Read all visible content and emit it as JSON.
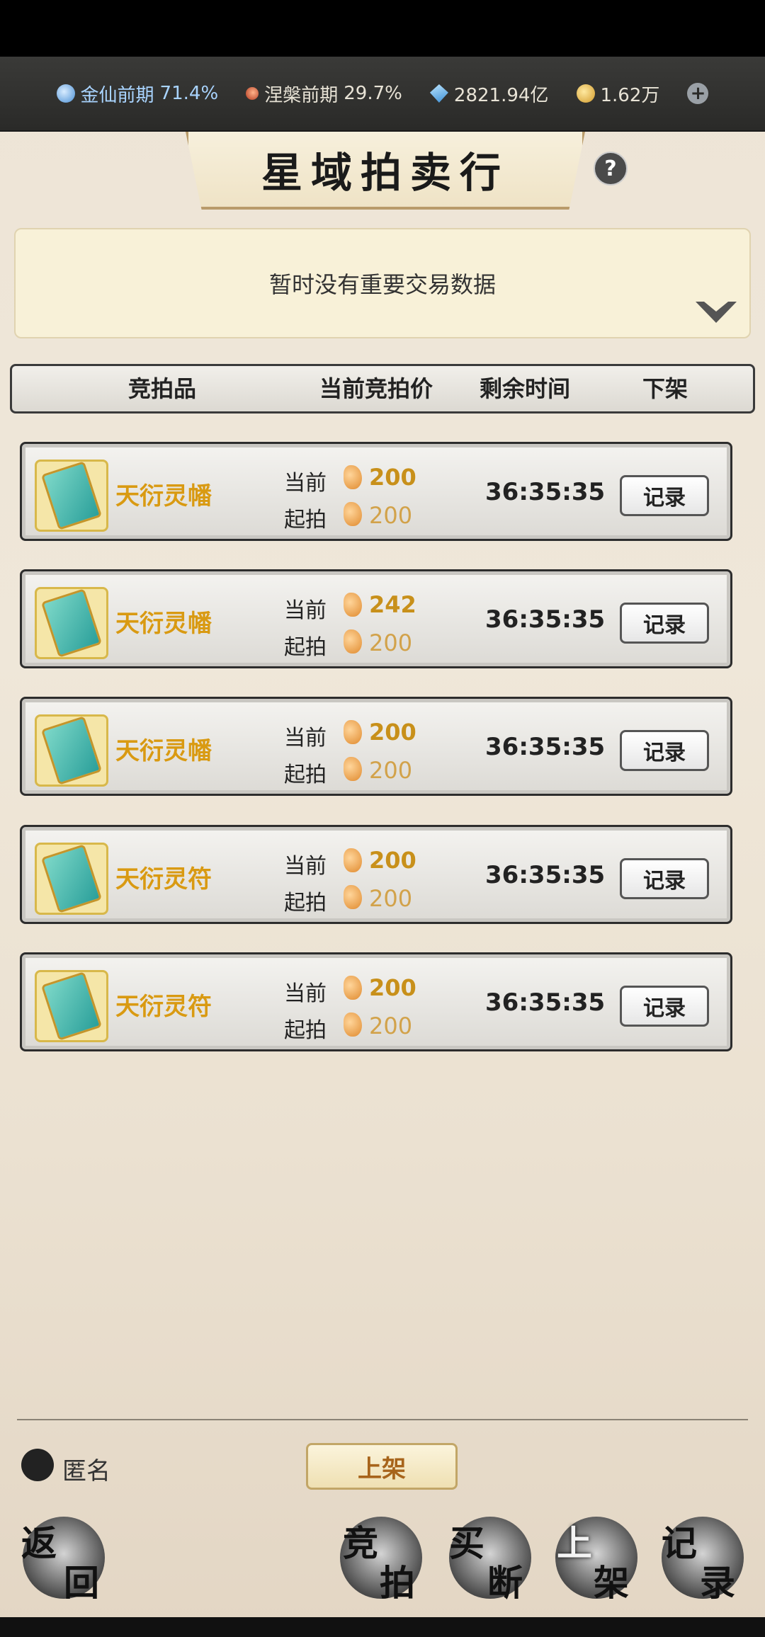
{
  "status": {
    "realm1": {
      "name": "金仙前期",
      "pct": "71.4%"
    },
    "realm2": {
      "name": "涅槃前期",
      "pct": "29.7%"
    },
    "gems": "2821.94亿",
    "gold": "1.62万",
    "add_icon": "plus-icon"
  },
  "title": "星域拍卖行",
  "help_label": "?",
  "notice": "暂时没有重要交易数据",
  "table_headers": {
    "item": "竞拍品",
    "price": "当前竞拍价",
    "time": "剩余时间",
    "delist": "下架"
  },
  "labels": {
    "current": "当前",
    "start": "起拍",
    "record": "记录"
  },
  "rows": [
    {
      "name": "天衍灵幡",
      "current": "200",
      "start": "200",
      "time": "36:35:35"
    },
    {
      "name": "天衍灵幡",
      "current": "242",
      "start": "200",
      "time": "36:35:35"
    },
    {
      "name": "天衍灵幡",
      "current": "200",
      "start": "200",
      "time": "36:35:35"
    },
    {
      "name": "天衍灵符",
      "current": "200",
      "start": "200",
      "time": "36:35:35"
    },
    {
      "name": "天衍灵符",
      "current": "200",
      "start": "200",
      "time": "36:35:35"
    }
  ],
  "footer": {
    "anonymous": "匿名",
    "list_button": "上架"
  },
  "nav": {
    "back": [
      "返",
      "回"
    ],
    "bid": [
      "竞",
      "拍"
    ],
    "buyout": [
      "买",
      "断"
    ],
    "list": [
      "上",
      "架"
    ],
    "records": [
      "记",
      "录"
    ]
  }
}
